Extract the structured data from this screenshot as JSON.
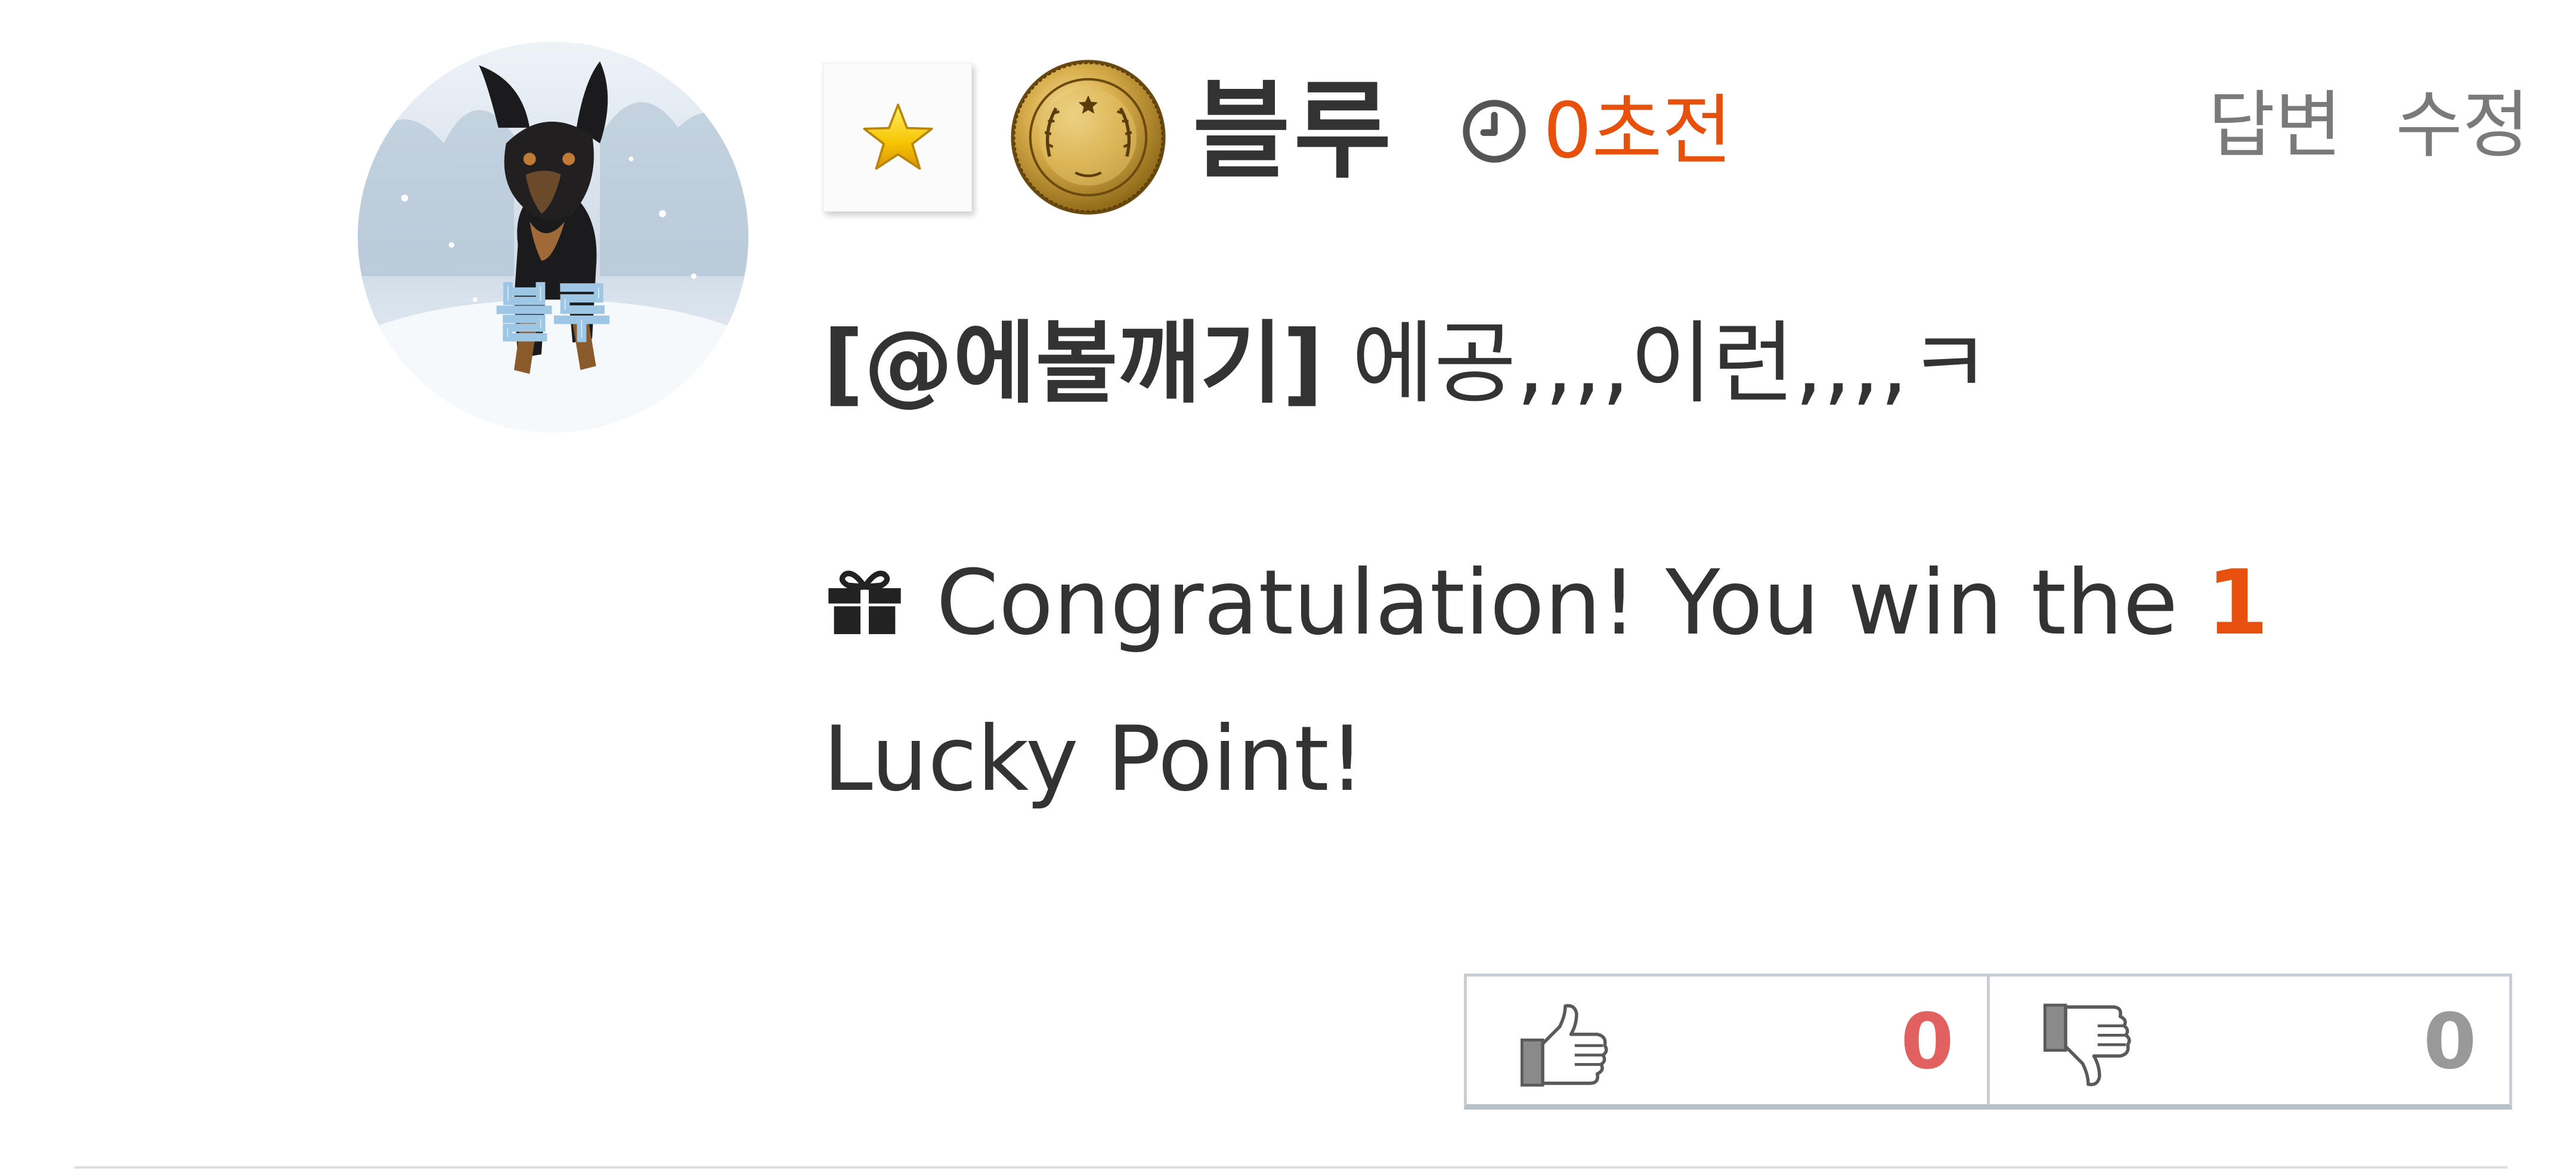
{
  "comment": {
    "author": {
      "name": "블루",
      "avatar_caption": "블루",
      "level_icon": "star-icon",
      "rank_icon": "gold-medal-icon"
    },
    "time": {
      "icon": "clock-icon",
      "text": "0초전"
    },
    "actions": {
      "reply_label": "답변",
      "edit_label": "수정"
    },
    "body": {
      "mention": "[@에볼깨기]",
      "text": " 에공,,,,이런,,,,ㅋ"
    },
    "lucky_point": {
      "icon": "gift-icon",
      "prefix": "Congratulation! You win the ",
      "points": "1",
      "suffix": " Lucky Point!"
    },
    "votes": {
      "up_count": "0",
      "down_count": "0",
      "up_icon": "thumbs-up-icon",
      "down_icon": "thumbs-down-icon"
    }
  },
  "colors": {
    "accent": "#e8500e",
    "upvote": "#e36060",
    "downvote": "#999999",
    "muted": "#7a7a7a",
    "text": "#333333"
  }
}
